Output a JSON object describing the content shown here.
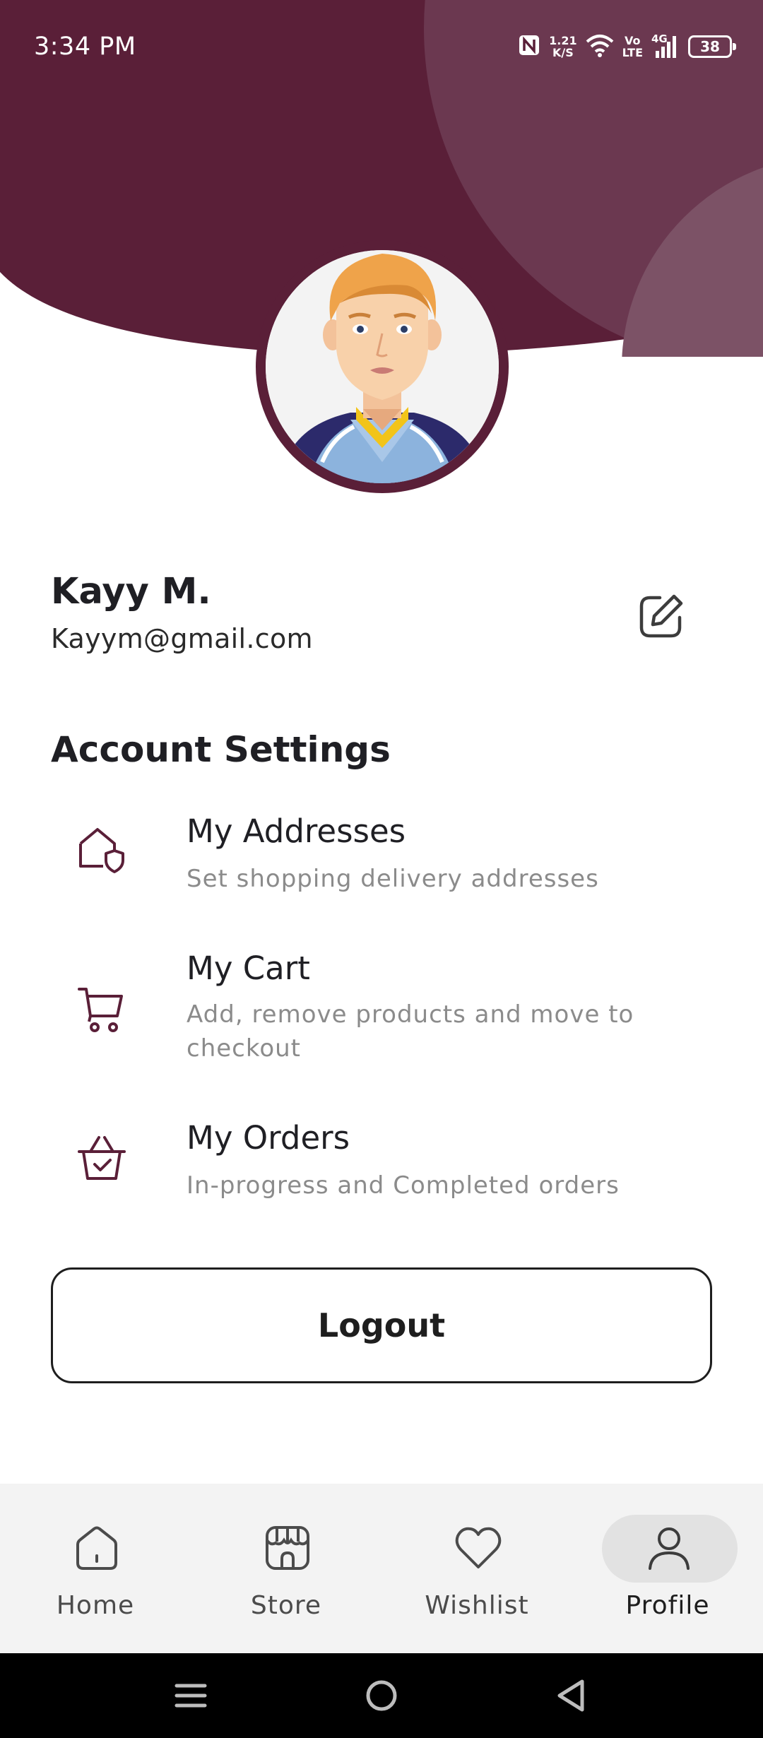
{
  "status_bar": {
    "time": "3:34 PM",
    "data_speed": "1.21",
    "data_speed_unit": "K/S",
    "volte_top": "Vo",
    "volte_bottom": "LTE",
    "network": "4G",
    "battery": "38"
  },
  "profile": {
    "name": "Kayy M.",
    "email": "Kayym@gmail.com"
  },
  "account_settings": {
    "title": "Account Settings",
    "items": [
      {
        "title": "My Addresses",
        "subtitle": "Set shopping delivery addresses",
        "icon": "house-shield-icon"
      },
      {
        "title": "My Cart",
        "subtitle": "Add, remove products and move to checkout",
        "icon": "cart-icon"
      },
      {
        "title": "My Orders",
        "subtitle": "In-progress and Completed orders",
        "icon": "basket-check-icon"
      }
    ]
  },
  "logout_label": "Logout",
  "bottom_nav": {
    "items": [
      {
        "label": "Home",
        "icon": "home-icon",
        "active": false
      },
      {
        "label": "Store",
        "icon": "store-icon",
        "active": false
      },
      {
        "label": "Wishlist",
        "icon": "heart-icon",
        "active": false
      },
      {
        "label": "Profile",
        "icon": "user-icon",
        "active": true
      }
    ]
  },
  "colors": {
    "brand": "#5a1f38",
    "brand_light": "#6b3850",
    "muted_text": "#8b8b8b",
    "nav_bg": "#f3f3f3",
    "active_pill": "#e2e2e2"
  }
}
